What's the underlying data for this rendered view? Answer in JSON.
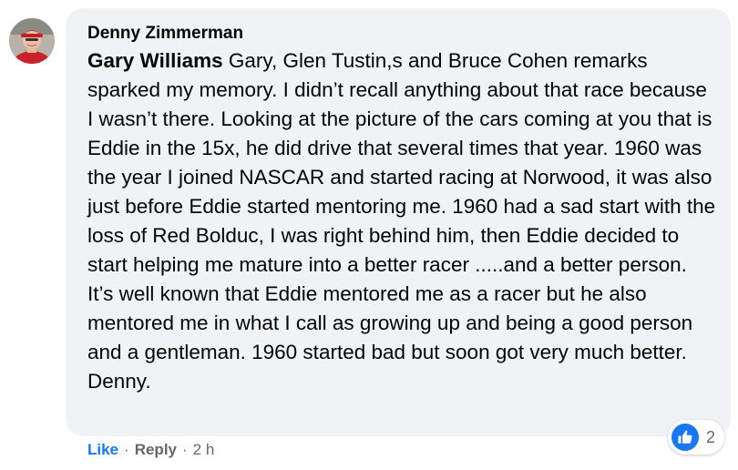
{
  "comment": {
    "author": "Denny Zimmerman",
    "mention": "Gary Williams",
    "text": " Gary, Glen Tustin,s and Bruce Cohen remarks sparked my memory. I didn’t recall anything about that race because I wasn’t there. Looking at the picture of the cars coming at you that is Eddie in the 15x, he did drive that several times that year. 1960 was the year I joined NASCAR and started racing at Norwood, it was also just before Eddie started mentoring me. 1960 had a sad start with the loss of Red Bolduc, I was right behind him, then Eddie decided to start helping me mature into a better racer .....and a better person. It’s well known that Eddie mentored me as a racer but he also mentored me in what I call as growing up and being a good person and a gentleman. 1960 started bad but soon got very much better. Denny.",
    "reaction_icon": "thumbs-up-icon",
    "reaction_count": "2"
  },
  "actions": {
    "like_label": "Like",
    "separator": "·",
    "reply_label": "Reply",
    "timestamp": "2 h"
  },
  "colors": {
    "bubble_bg": "#f0f2f5",
    "link_blue": "#1877f2",
    "meta_gray": "#65676b",
    "text": "#050505"
  }
}
